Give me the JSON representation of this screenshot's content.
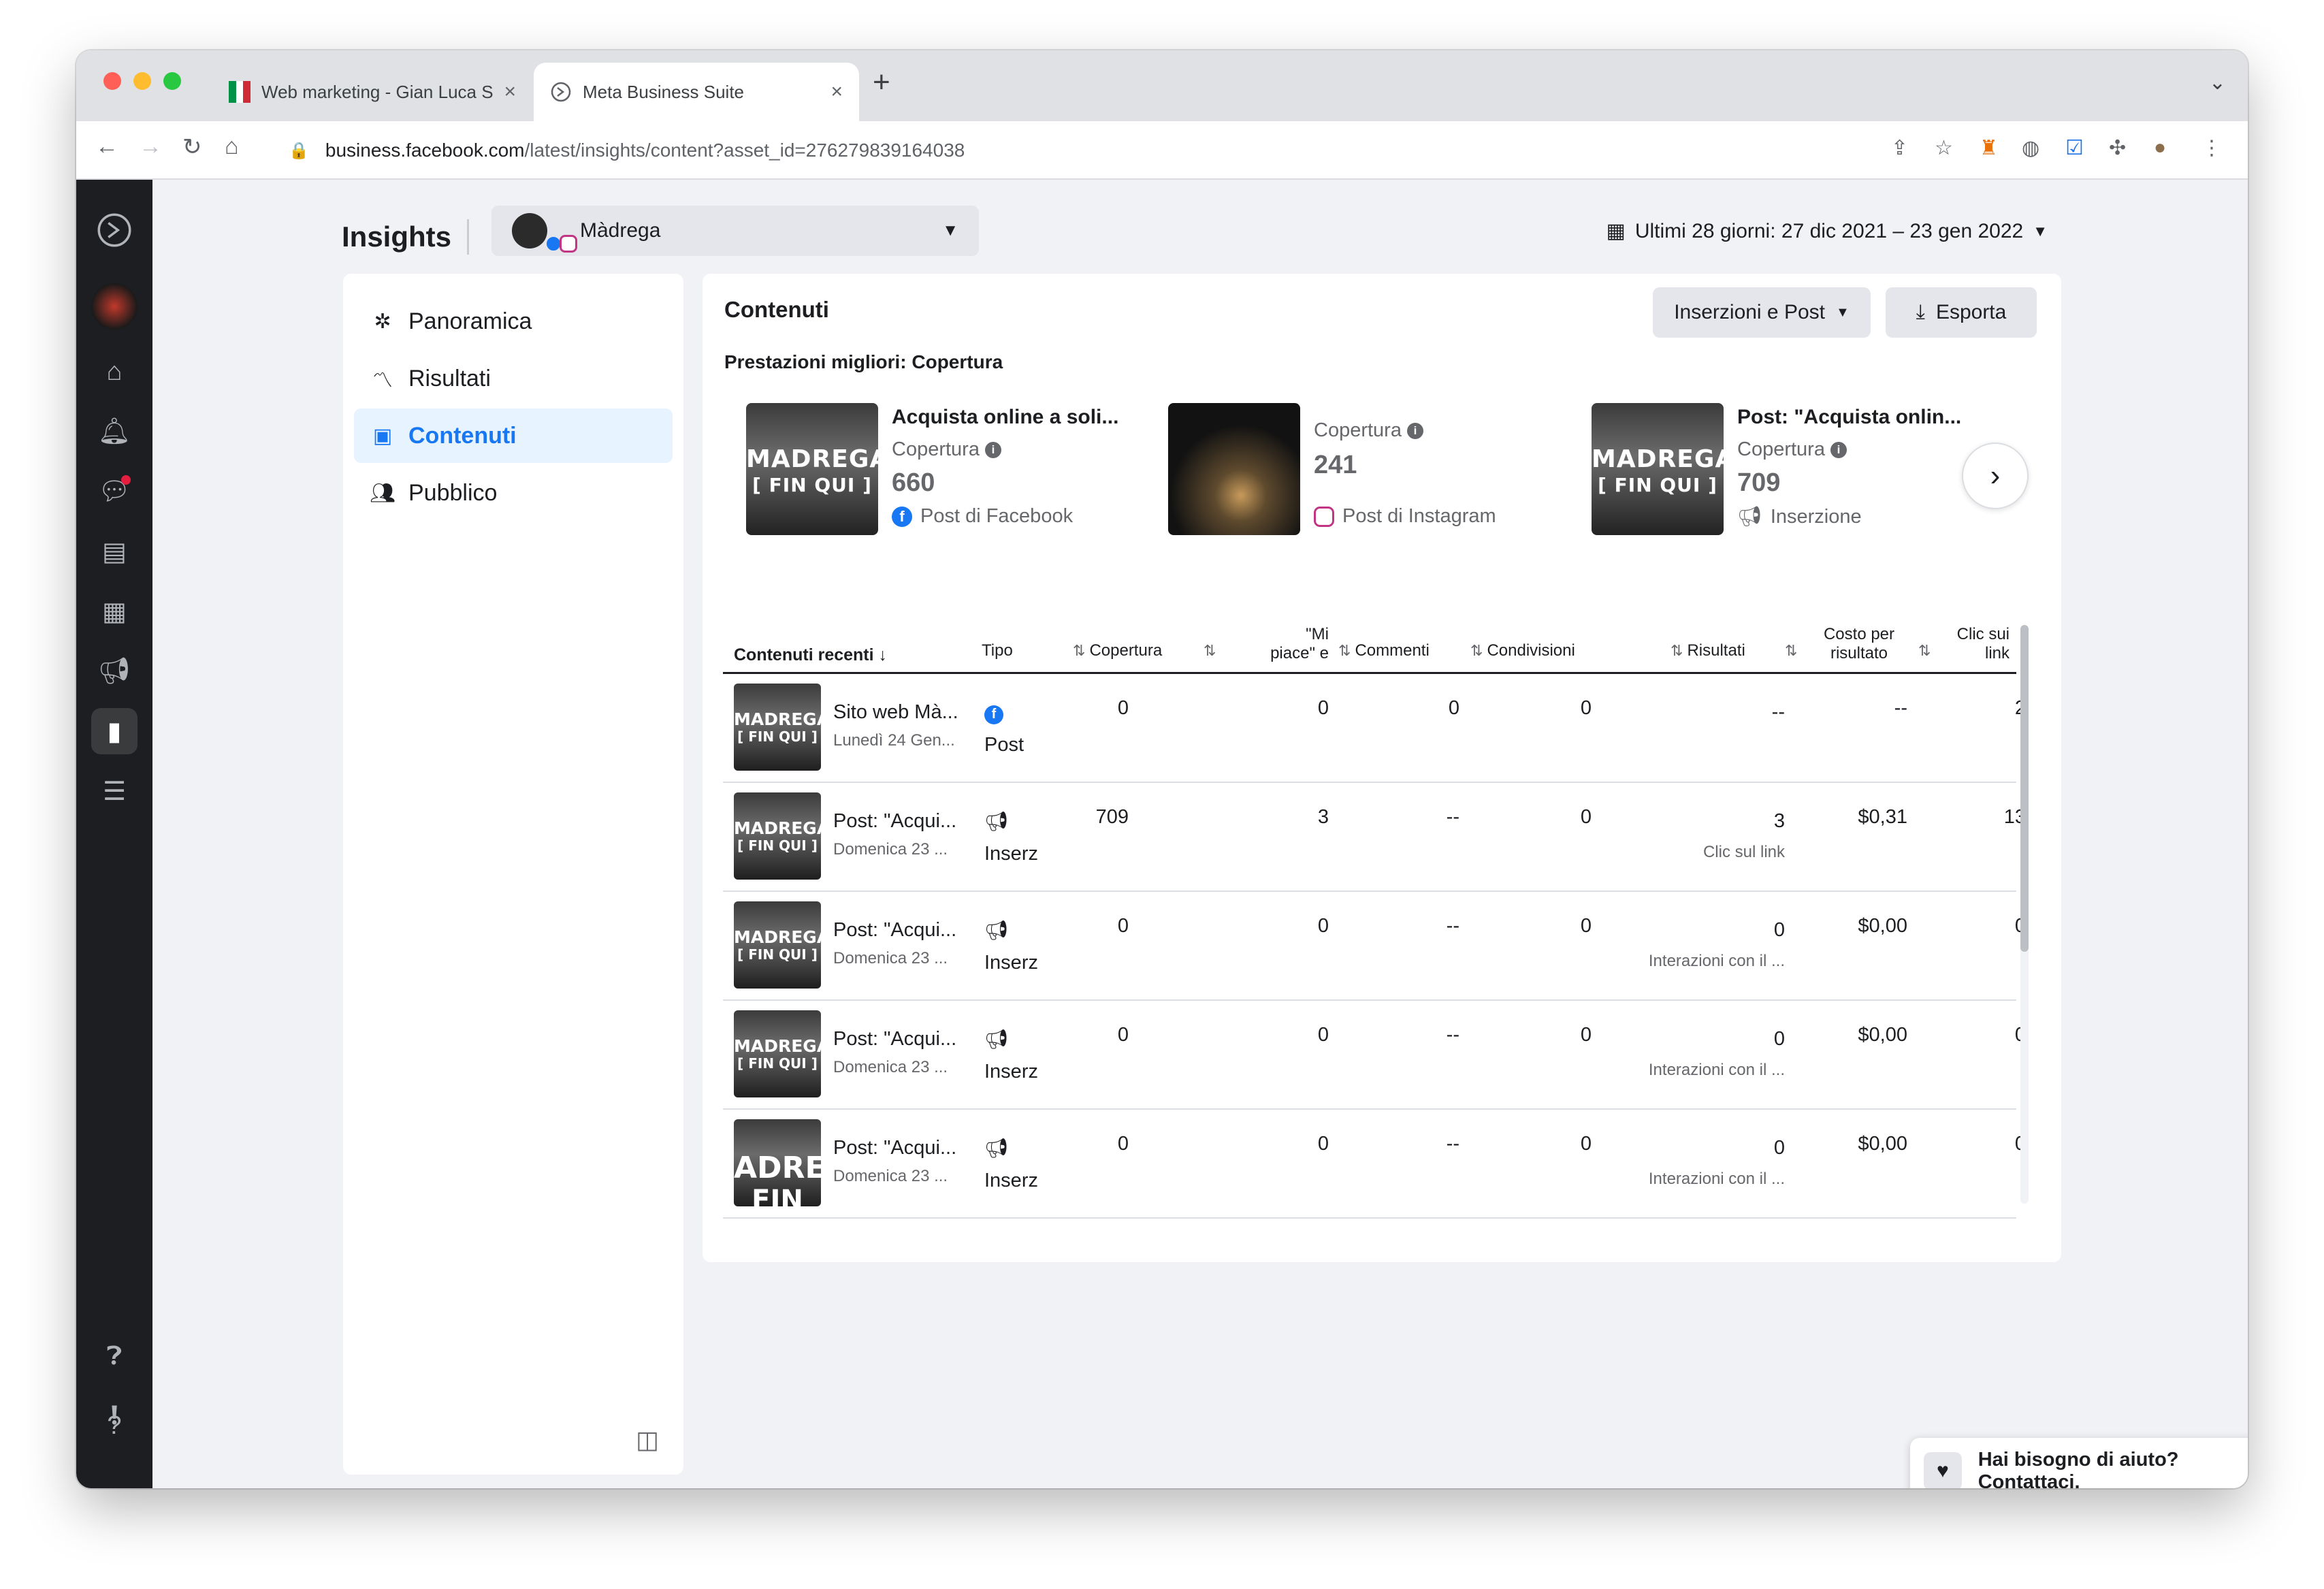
{
  "browser": {
    "tabs": [
      {
        "title": "Web marketing - Gian Luca Sh",
        "active": false
      },
      {
        "title": "Meta Business Suite",
        "active": true
      }
    ],
    "url_domain": "business.facebook.com",
    "url_path": "/latest/insights/content?asset_id=276279839164038"
  },
  "header": {
    "title": "Insights",
    "account_name": "Màdrega",
    "date_range": "Ultimi 28 giorni: 27 dic 2021 – 23 gen 2022"
  },
  "leftnav": {
    "items": [
      {
        "label": "Panoramica",
        "icon": "overview-icon",
        "selected": false
      },
      {
        "label": "Risultati",
        "icon": "results-icon",
        "selected": false
      },
      {
        "label": "Contenuti",
        "icon": "content-icon",
        "selected": true
      },
      {
        "label": "Pubblico",
        "icon": "audience-icon",
        "selected": false
      }
    ]
  },
  "main": {
    "title": "Contenuti",
    "filter_label": "Inserzioni e Post",
    "export_label": "Esporta",
    "top_title": "Prestazioni migliori: Copertura",
    "top_items": [
      {
        "title": "Acquista online a soli...",
        "metric_label": "Copertura",
        "value": "660",
        "type": "Post di Facebook",
        "thumb_text": "MADREGA",
        "thumb_text2": "[ FIN QUI ]"
      },
      {
        "title": "",
        "metric_label": "Copertura",
        "value": "241",
        "type": "Post di Instagram",
        "thumb_text": "",
        "thumb_text2": ""
      },
      {
        "title": "Post: \"Acquista onlin...",
        "metric_label": "Copertura",
        "value": "709",
        "type": "Inserzione",
        "thumb_text": "MADREGA",
        "thumb_text2": "[ FIN QUI ]"
      }
    ],
    "table": {
      "headers": {
        "content": "Contenuti recenti",
        "type": "Tipo",
        "reach": "Copertura",
        "likes_line1": "\"Mi",
        "likes_line2": "piace\" e",
        "comments": "Commenti",
        "shares": "Condivisioni",
        "results": "Risultati",
        "cost_line1": "Costo per",
        "cost_line2": "risultato",
        "clicks_line1": "Clic sui",
        "clicks_line2": "link"
      },
      "rows": [
        {
          "title": "Sito web Mà...",
          "date": "Lunedì 24 Gen...",
          "type": "Post",
          "type_icon": "facebook-icon",
          "reach": "0",
          "likes": "0",
          "comments": "0",
          "shares": "0",
          "results": "--",
          "results_sub": "",
          "cost": "--",
          "clicks": "2",
          "thumb_text": "MADREGA",
          "thumb_text2": "[ FIN QUI ]"
        },
        {
          "title": "Post: \"Acqui...",
          "date": "Domenica 23 ...",
          "type": "Inserz",
          "type_icon": "megaphone-icon",
          "reach": "709",
          "likes": "3",
          "comments": "--",
          "shares": "0",
          "results": "3",
          "results_sub": "Clic sul link",
          "cost": "$0,31",
          "clicks": "13",
          "thumb_text": "MADREGA",
          "thumb_text2": "[ FIN QUI ]"
        },
        {
          "title": "Post: \"Acqui...",
          "date": "Domenica 23 ...",
          "type": "Inserz",
          "type_icon": "megaphone-icon",
          "reach": "0",
          "likes": "0",
          "comments": "--",
          "shares": "0",
          "results": "0",
          "results_sub": "Interazioni con il ...",
          "cost": "$0,00",
          "clicks": "0",
          "thumb_text": "MADREGA",
          "thumb_text2": "[ FIN QUI ]"
        },
        {
          "title": "Post: \"Acqui...",
          "date": "Domenica 23 ...",
          "type": "Inserz",
          "type_icon": "megaphone-icon",
          "reach": "0",
          "likes": "0",
          "comments": "--",
          "shares": "0",
          "results": "0",
          "results_sub": "Interazioni con il ...",
          "cost": "$0,00",
          "clicks": "0",
          "thumb_text": "MADREGA",
          "thumb_text2": "[ FIN QUI ]"
        },
        {
          "title": "Post: \"Acqui...",
          "date": "Domenica 23 ...",
          "type": "Inserz",
          "type_icon": "megaphone-icon",
          "reach": "0",
          "likes": "0",
          "comments": "--",
          "shares": "0",
          "results": "0",
          "results_sub": "Interazioni con il ...",
          "cost": "$0,00",
          "clicks": "0",
          "thumb_text": "ADREG",
          "thumb_text2": "FIN QUI"
        }
      ]
    }
  },
  "help": {
    "label": "Hai bisogno di aiuto? Contattaci."
  },
  "colors": {
    "accent": "#1877f2",
    "rail": "#1c1e21",
    "page_bg": "#f0f2f5"
  }
}
